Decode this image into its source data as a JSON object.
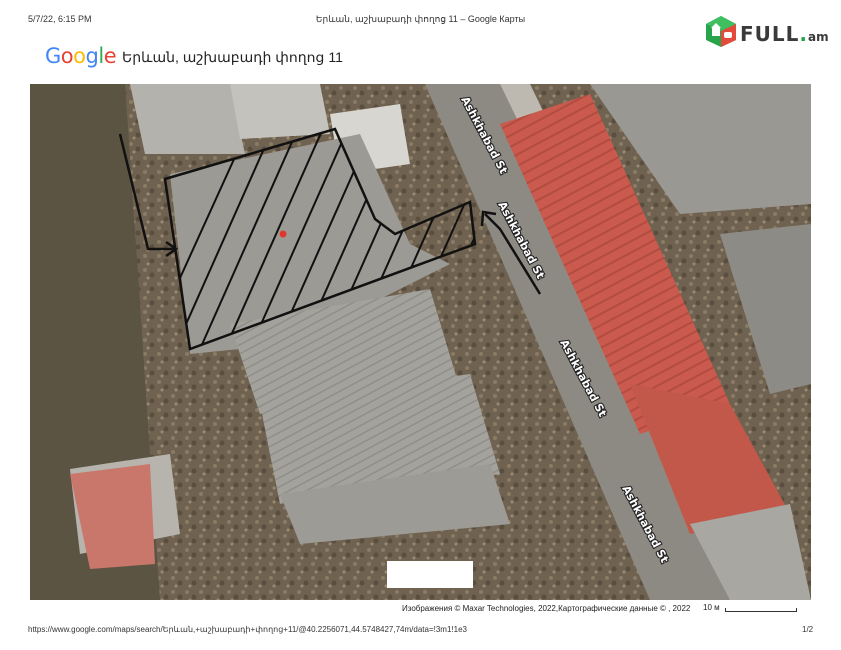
{
  "print_header": {
    "datetime": "5/7/22, 6:15 PM",
    "title": "Երևան, աշխաբադի փողոց 11 – Google Карты"
  },
  "watermark_logo": {
    "name": "FULL",
    "tld": "am",
    "icon": "fullam-house-icon"
  },
  "google_logo": [
    "G",
    "o",
    "o",
    "g",
    "l",
    "e"
  ],
  "search": {
    "query": "Երևան, աշխաբադի փողոց 11"
  },
  "map": {
    "view": "satellite",
    "road_labels": [
      "Ashkhabad St",
      "Ashkhabad St",
      "Ashkhabad St",
      "Ashkhabad St"
    ],
    "marker_color": "#e0372b",
    "hatch_color": "#111111"
  },
  "attribution": "Изображения © Maxar Technologies, 2022,Картографические данные © , 2022",
  "scale": {
    "label": "10 м"
  },
  "print_footer": {
    "url": "https://www.google.com/maps/search/Երևան,+աշխաբադի+փողոց+11/@40.2256071,44.5748427,74m/data=!3m1!1e3",
    "page": "1/2"
  }
}
